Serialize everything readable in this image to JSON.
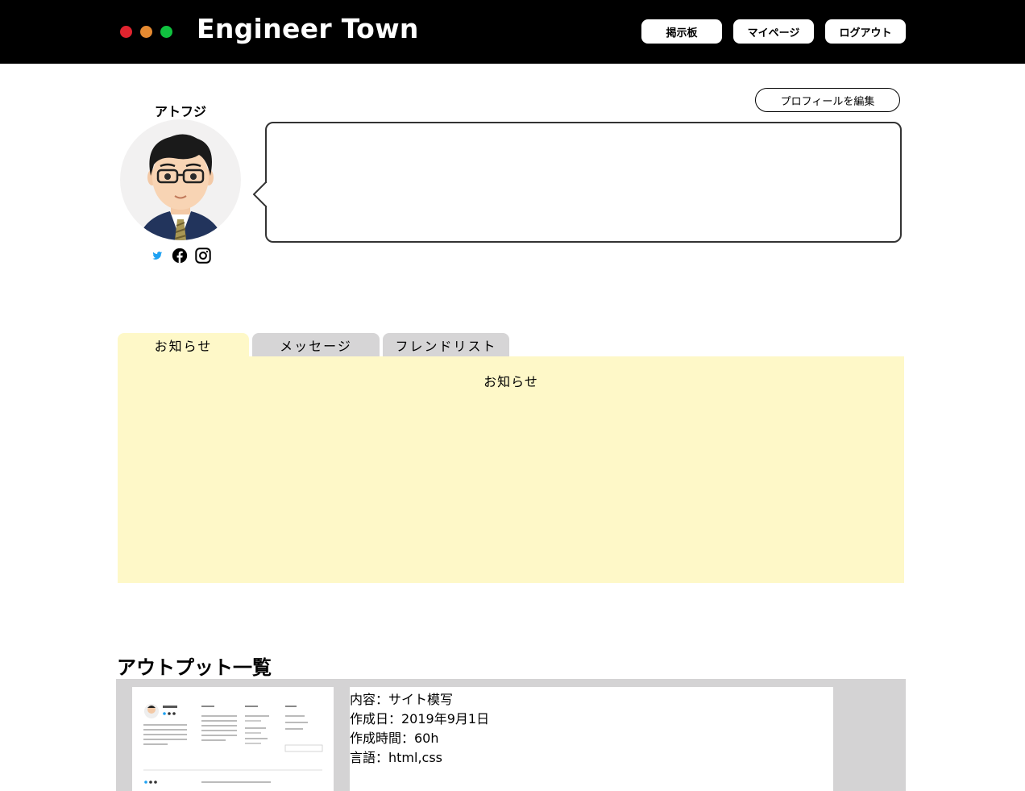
{
  "header": {
    "logo": "Engineer Town",
    "window_dots": [
      "#e0242f",
      "#e58a31",
      "#10c23f"
    ],
    "nav": [
      {
        "label": "掲示板"
      },
      {
        "label": "マイページ"
      },
      {
        "label": "ログアウト"
      }
    ]
  },
  "profile": {
    "username": "アトフジ",
    "edit_button": "プロフィールを編集",
    "bio": "",
    "social": [
      "twitter-icon",
      "facebook-icon",
      "instagram-icon"
    ],
    "twitter_color": "#1da1f2"
  },
  "tabs": {
    "items": [
      {
        "label": "お知らせ",
        "active": true
      },
      {
        "label": "メッセージ",
        "active": false
      },
      {
        "label": "フレンドリスト",
        "active": false
      }
    ],
    "panel_title": "お知らせ",
    "active_color": "#fef8c8",
    "inactive_color": "#d6d5d6"
  },
  "outputs": {
    "title": "アウトプット一覧",
    "items": [
      {
        "content": "内容：サイト模写",
        "created": "作成日：2019年9月1日",
        "hours": "作成時間：60h",
        "language": "言語：html,css",
        "thumbnail": {
          "site_title": "ATOFUJI",
          "sections": [
            "プロフィール",
            "最近の投稿",
            "カテゴリー"
          ]
        }
      }
    ]
  }
}
